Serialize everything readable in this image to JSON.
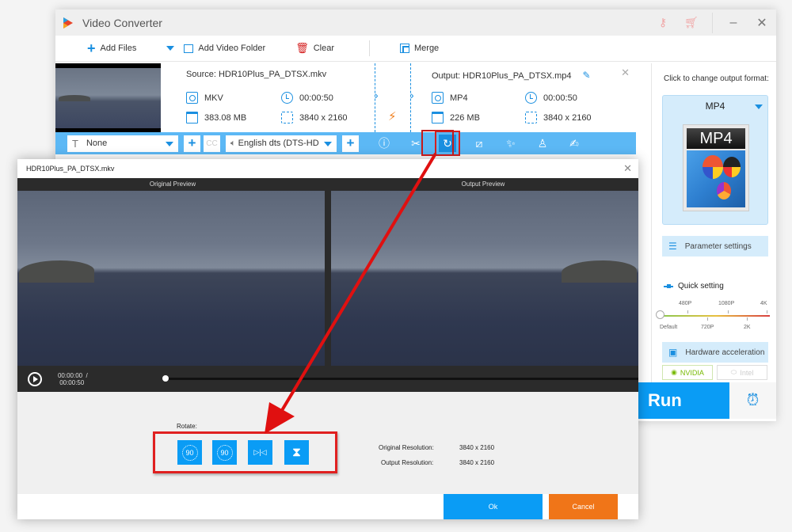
{
  "app": {
    "title": "Video Converter"
  },
  "titlebar": {
    "icons": [
      "key-icon",
      "cart-icon"
    ],
    "minimize": "–",
    "close": "✕"
  },
  "toolbar": {
    "add_files": "Add Files",
    "add_folder": "Add Video Folder",
    "clear": "Clear",
    "merge": "Merge"
  },
  "file": {
    "source_label": "Source: HDR10Plus_PA_DTSX.mkv",
    "source_format": "MKV",
    "source_duration": "00:00:50",
    "source_size": "383.08 MB",
    "source_resolution": "3840 x 2160",
    "output_label": "Output: HDR10Plus_PA_DTSX.mp4",
    "output_format": "MP4",
    "output_duration": "00:00:50",
    "output_size": "226 MB",
    "output_resolution": "3840 x 2160"
  },
  "edit_bar": {
    "subtitle_value": "None",
    "subtitle_icon": "T",
    "cc_label": "CC",
    "audio_value": "English dts (DTS-HD",
    "tools": [
      "info-icon",
      "scissors-icon",
      "rotate-icon",
      "crop-icon",
      "effects-icon",
      "watermark-icon",
      "subtitle-edit-icon"
    ]
  },
  "right_panel": {
    "change_format_label": "Click to change output format:",
    "format": "MP4",
    "format_icon_label": "MP4",
    "parameter_settings": "Parameter settings",
    "quick_setting": "Quick setting",
    "quality_ticks_top": [
      "480P",
      "1080P",
      "4K"
    ],
    "quality_ticks_bottom": [
      "Default",
      "720P",
      "2K"
    ],
    "quality_selected": "Default",
    "hardware_acceleration": "Hardware acceleration",
    "nvidia": "NVIDIA",
    "intel": "Intel"
  },
  "run": {
    "label": "Run"
  },
  "dialog": {
    "title": "HDR10Plus_PA_DTSX.mkv",
    "original_preview": "Original Preview",
    "output_preview": "Output Preview",
    "current_time": "00:00:00",
    "separator": "/",
    "total_time": "00:00:50",
    "progress": 0,
    "rotate_label": "Rotate:",
    "rotate_buttons": [
      {
        "name": "rotate-left-90",
        "label": "90"
      },
      {
        "name": "rotate-right-90",
        "label": "90"
      },
      {
        "name": "flip-horizontal",
        "label": "▷|◁"
      },
      {
        "name": "flip-vertical",
        "label": "⧗"
      }
    ],
    "original_resolution_label": "Original Resolution:",
    "original_resolution": "3840 x 2160",
    "output_resolution_label": "Output Resolution:",
    "output_resolution": "3840 x 2160",
    "ok": "Ok",
    "cancel": "Cancel"
  },
  "colors": {
    "accent": "#0a9cf5",
    "cancel": "#f07518",
    "highlight": "#e02020",
    "editbar": "#5cb8f5"
  }
}
